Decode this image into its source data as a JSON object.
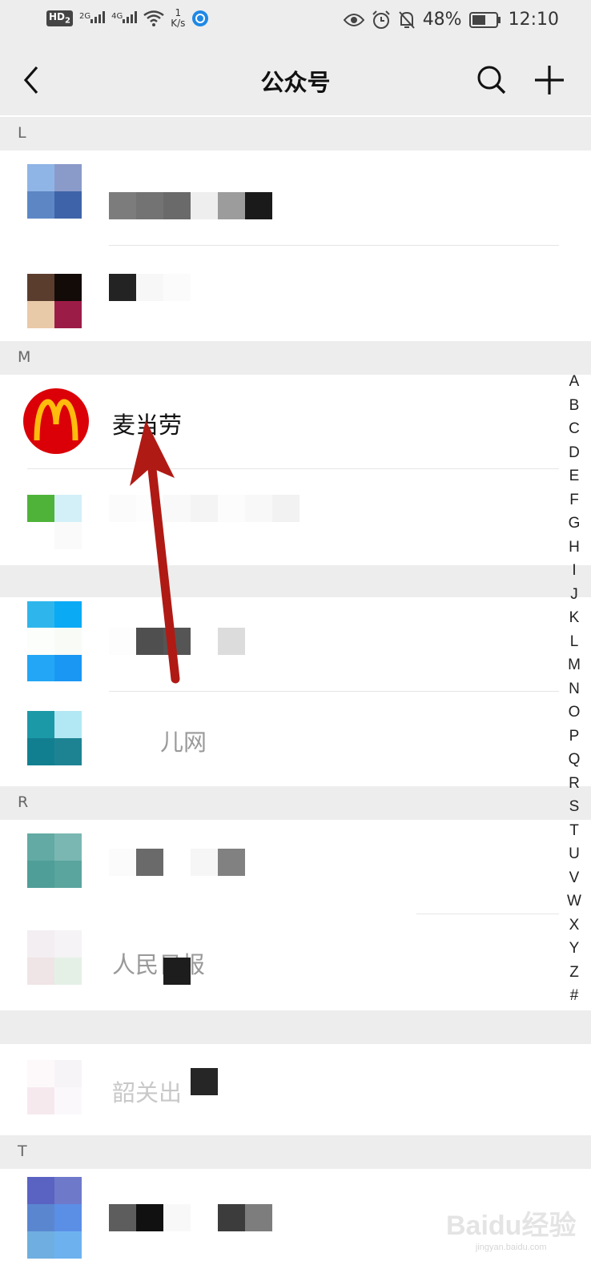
{
  "status_bar": {
    "hd_badge": "HD",
    "hd_sub": "2",
    "net1": "2G",
    "net2": "4G",
    "speed_value": "1",
    "speed_unit": "K/s",
    "battery": "48%",
    "time": "12:10"
  },
  "navbar": {
    "title": "公众号",
    "back_icon": "chevron-left-icon",
    "search_icon": "search-icon",
    "add_icon": "plus-icon"
  },
  "sections": {
    "l": "L",
    "m": "M",
    "r": "R",
    "t": "T"
  },
  "accounts": {
    "mcdonalds": "麦当劳",
    "blurred_4": "儿网",
    "blurred_6": "人民日报",
    "blurred_7": "韶关出"
  },
  "index_bar": [
    "A",
    "B",
    "C",
    "D",
    "E",
    "F",
    "G",
    "H",
    "I",
    "J",
    "K",
    "L",
    "M",
    "N",
    "O",
    "P",
    "Q",
    "R",
    "S",
    "T",
    "U",
    "V",
    "W",
    "X",
    "Y",
    "Z",
    "#"
  ],
  "watermark": {
    "logo": "Baidu经验",
    "url": "jingyan.baidu.com"
  },
  "colors": {
    "background": "#ededed",
    "mcdonalds_red": "#db0007",
    "mcdonalds_yellow": "#ffbc0d",
    "annotation_arrow": "#b01a14"
  }
}
